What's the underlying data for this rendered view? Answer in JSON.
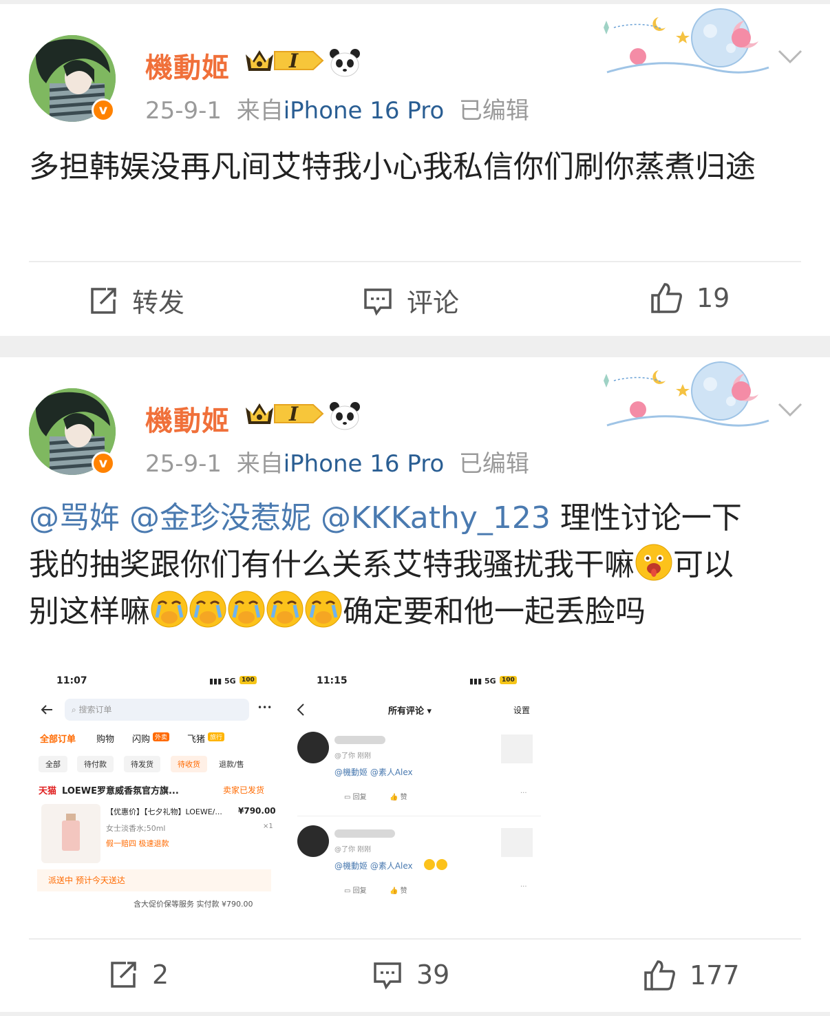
{
  "posts": [
    {
      "username": "機動姬",
      "level_badge": "I",
      "date": "25-9-1",
      "source_prefix": "来自",
      "source_device": "iPhone 16 Pro",
      "edited": "已编辑",
      "text": "多担韩娱没再凡间艾特我小心我私信你们刷你蒸煮归途",
      "actions": {
        "repost": "转发",
        "comment": "评论",
        "like": "19"
      }
    },
    {
      "username": "機動姬",
      "level_badge": "I",
      "date": "25-9-1",
      "source_prefix": "来自",
      "source_device": "iPhone 16 Pro",
      "edited": "已编辑",
      "mentions": [
        "@骂姩",
        "@金珍没惹妮",
        "@KKKathy_123"
      ],
      "text_line1": "理性讨论一下",
      "text_line2": "我的抽奖跟你们有什么关系艾特我骚扰我干嘛",
      "text_line2b": "可以",
      "text_line3a": "别这样嘛",
      "text_line3b": "确定要和他一起丢脸吗",
      "actions": {
        "repost": "2",
        "comment": "39",
        "like": "177"
      }
    }
  ],
  "screenshot_left": {
    "time": "11:07",
    "signal": "5G",
    "battery": "100",
    "search_placeholder": "搜索订单",
    "more": "•••",
    "tabs": [
      "全部订单",
      "购物",
      "闪购",
      "飞猪"
    ],
    "tab_tags": [
      "外卖",
      "旅行"
    ],
    "filters": [
      "全部",
      "待付款",
      "待发货",
      "待收货",
      "退款/售"
    ],
    "store": "LOEWE罗意威香氛官方旗...",
    "store_prefix": "天猫",
    "store_status": "卖家已发货",
    "product_title": "【优惠价】【七夕礼物】LOEWE/...",
    "product_price": "¥790.00",
    "product_spec": "女士淡香水;50ml",
    "product_qty": "×1",
    "product_tags": "假一赔四 极速退款",
    "delivery": "派送中  预计今天送达",
    "summary": "含大促价保等服务  实付款 ¥790.00"
  },
  "screenshot_right": {
    "time": "11:15",
    "signal": "5G",
    "battery": "100",
    "title": "所有评论 ▾",
    "settings": "设置",
    "comments": [
      {
        "meta": "@了你  刚刚",
        "text": "@機動姬 @素人Alex",
        "reply": "回复",
        "like": "赞"
      },
      {
        "meta": "@了你  刚刚",
        "text": "@機動姬 @素人Alex",
        "reply": "回复",
        "like": "赞"
      }
    ]
  },
  "colors": {
    "username": "#f0703a",
    "mention": "#4a7ab0",
    "verified": "#ff8200",
    "meta": "#9a9a9a"
  }
}
